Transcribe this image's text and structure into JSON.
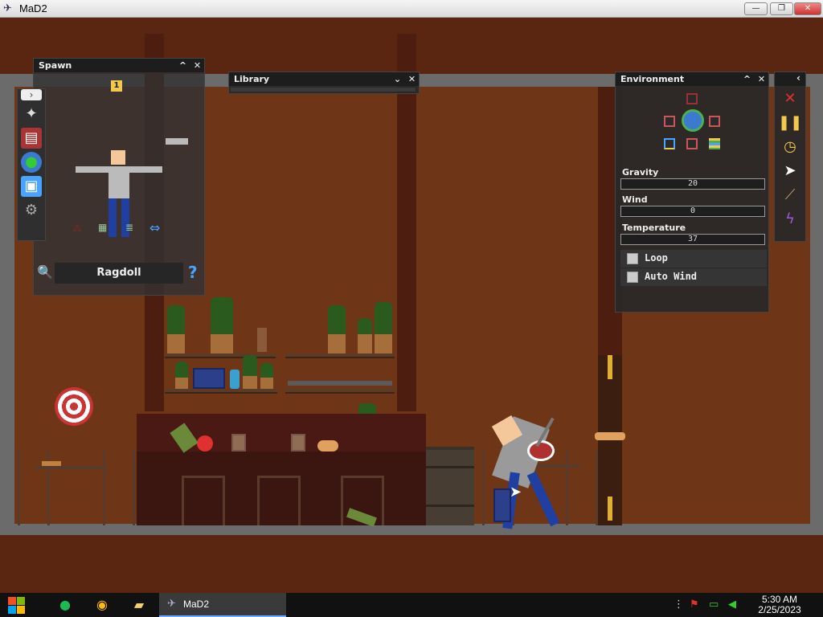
{
  "window": {
    "title": "MaD2",
    "minimize": "—",
    "maximize": "❐",
    "close": "✕"
  },
  "spawn_panel": {
    "title": "Spawn",
    "collapse": "^",
    "close": "✕",
    "expand": "›",
    "count_badge": "1",
    "selected_name": "Ragdoll",
    "help": "?",
    "sidebar": [
      "ragdoll-icon",
      "book-icon",
      "globe-icon",
      "save-icon",
      "gear-icon"
    ]
  },
  "library_panel": {
    "title": "Library",
    "dropdown": "⌄",
    "close": "✕"
  },
  "environment_panel": {
    "title": "Environment",
    "collapse": "^",
    "close": "✕",
    "gravity_label": "Gravity",
    "gravity_value": "20",
    "wind_label": "Wind",
    "wind_value": "0",
    "temperature_label": "Temperature",
    "temperature_value": "37",
    "loop_label": "Loop",
    "loop_checked": false,
    "autowind_label": "Auto Wind",
    "autowind_checked": false
  },
  "toolbar": {
    "collapse": "‹",
    "tools": [
      "delete-icon",
      "pause-icon",
      "timer-icon",
      "cursor-icon",
      "knife-icon",
      "lightning-icon"
    ]
  },
  "taskbar": {
    "app_label": "MaD2",
    "time": "5:30 AM",
    "date": "2/25/2023"
  },
  "colors": {
    "wall": "#6e3517",
    "frame": "#6b6b6b",
    "panel": "#2e2e2e",
    "accent": "#f2c94c"
  }
}
